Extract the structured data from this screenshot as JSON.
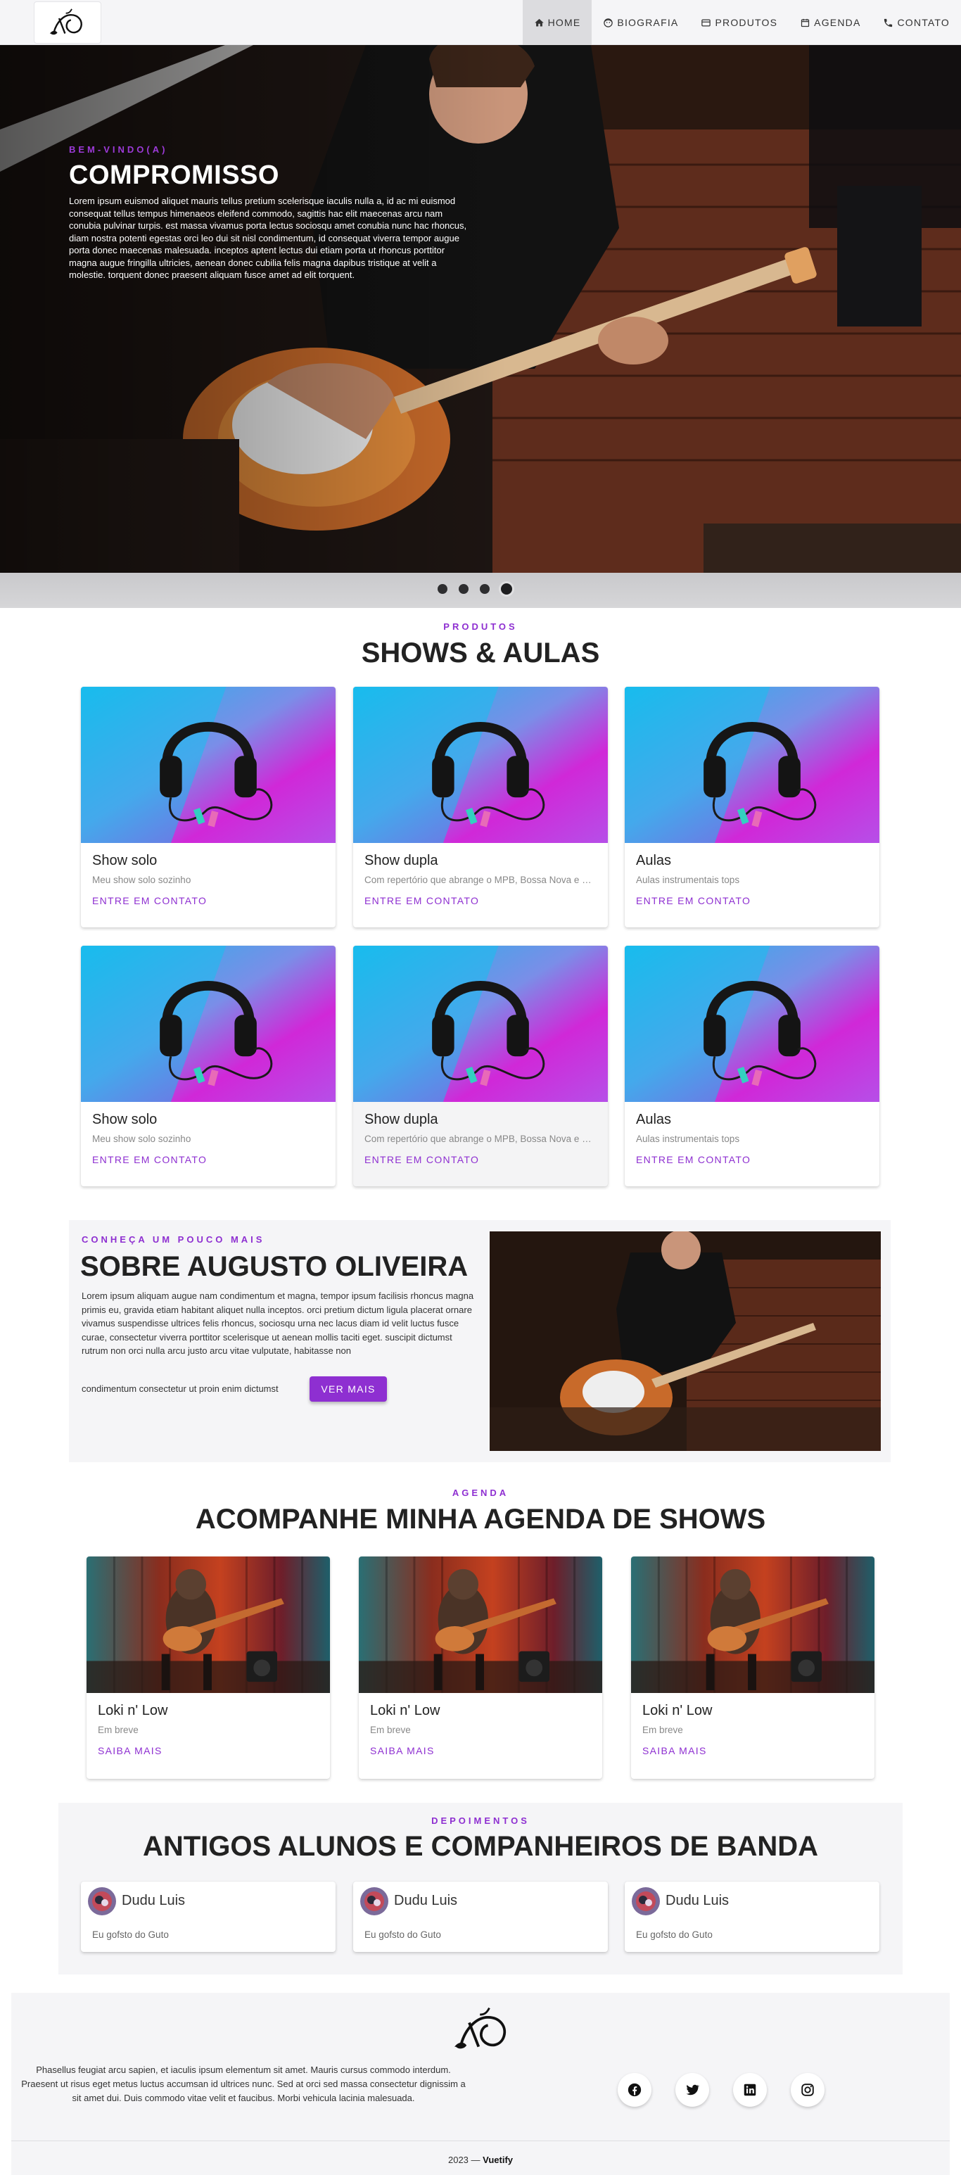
{
  "nav": {
    "items": [
      {
        "label": "HOME",
        "icon": "home-icon",
        "active": true
      },
      {
        "label": "BIOGRAFIA",
        "icon": "face-icon",
        "active": false
      },
      {
        "label": "PRODUTOS",
        "icon": "card-icon",
        "active": false
      },
      {
        "label": "AGENDA",
        "icon": "calendar-icon",
        "active": false
      },
      {
        "label": "CONTATO",
        "icon": "phone-icon",
        "active": false
      }
    ]
  },
  "hero": {
    "eyebrow": "BEM-VINDO(A)",
    "title": "COMPROMISSO",
    "body": "Lorem ipsum euismod aliquet mauris tellus pretium scelerisque iaculis nulla a, id ac mi euismod consequat tellus tempus himenaeos eleifend commodo, sagittis hac elit maecenas arcu nam conubia pulvinar turpis. est massa vivamus porta lectus sociosqu amet conubia nunc hac rhoncus, diam nostra potenti egestas orci leo dui sit nisl condimentum, id consequat viverra tempor augue porta donec maecenas malesuada. inceptos aptent lectus dui etiam porta ut rhoncus porttitor magna augue fringilla ultricies, aenean donec cubilia felis magna dapibus tristique at velit a molestie. torquent donec praesent aliquam fusce amet ad elit torquent.",
    "carousel_count": 4,
    "carousel_active": 4
  },
  "products": {
    "eyebrow": "PRODUTOS",
    "title": "SHOWS & AULAS",
    "cards": [
      {
        "title": "Show solo",
        "subtitle": "Meu show solo sozinho",
        "action": "ENTRE EM CONTATO"
      },
      {
        "title": "Show dupla",
        "subtitle": "Com repertório que abrange o MPB, Bossa Nova e Rock",
        "action": "ENTRE EM CONTATO"
      },
      {
        "title": "Aulas",
        "subtitle": "Aulas instrumentais tops",
        "action": "ENTRE EM CONTATO"
      },
      {
        "title": "Show solo",
        "subtitle": "Meu show solo sozinho",
        "action": "ENTRE EM CONTATO"
      },
      {
        "title": "Show dupla",
        "subtitle": "Com repertório que abrange o MPB, Bossa Nova e Rock",
        "action": "ENTRE EM CONTATO"
      },
      {
        "title": "Aulas",
        "subtitle": "Aulas instrumentais tops",
        "action": "ENTRE EM CONTATO"
      }
    ]
  },
  "about": {
    "eyebrow": "CONHEÇA UM POUCO MAIS",
    "title": "SOBRE AUGUSTO OLIVEIRA",
    "body": "Lorem ipsum aliquam augue nam condimentum et magna, tempor ipsum facilisis rhoncus magna primis eu, gravida etiam habitant aliquet nulla inceptos. orci pretium dictum ligula placerat ornare vivamus suspendisse ultrices felis rhoncus, sociosqu urna nec lacus diam id velit luctus fusce curae, consectetur viverra porttitor scelerisque ut aenean mollis taciti eget. suscipit dictumst rutrum non orci nulla arcu justo arcu vitae vulputate, habitasse non",
    "tail": "condimentum consectetur ut proin enim dictumst",
    "button": "VER MAIS"
  },
  "agenda": {
    "eyebrow": "AGENDA",
    "title": "ACOMPANHE MINHA AGENDA DE SHOWS",
    "cards": [
      {
        "title": "Loki n' Low",
        "subtitle": "Em breve",
        "action": "SAIBA MAIS"
      },
      {
        "title": "Loki n' Low",
        "subtitle": "Em breve",
        "action": "SAIBA MAIS"
      },
      {
        "title": "Loki n' Low",
        "subtitle": "Em breve",
        "action": "SAIBA MAIS"
      }
    ]
  },
  "testimonials": {
    "eyebrow": "DEPOIMENTOS",
    "title": "ANTIGOS ALUNOS E COMPANHEIROS DE BANDA",
    "items": [
      {
        "name": "Dudu Luis",
        "text": "Eu gofsto do Guto"
      },
      {
        "name": "Dudu Luis",
        "text": "Eu gofsto do Guto"
      },
      {
        "name": "Dudu Luis",
        "text": "Eu gofsto do Guto"
      }
    ]
  },
  "footer": {
    "text": "Phasellus feugiat arcu sapien, et iaculis ipsum elementum sit amet. Mauris cursus commodo interdum. Praesent ut risus eget metus luctus accumsan id ultrices nunc. Sed at orci sed massa consectetur dignissim a sit amet dui. Duis commodo vitae velit et faucibus. Morbi vehicula lacinia malesuada.",
    "socials": [
      "facebook-icon",
      "twitter-icon",
      "linkedin-icon",
      "instagram-icon"
    ],
    "copyright_year": "2023 —",
    "copyright_brand": "Vuetify"
  },
  "colors": {
    "accent": "#8e2fd1",
    "nav_bg": "#f5f5f7"
  }
}
